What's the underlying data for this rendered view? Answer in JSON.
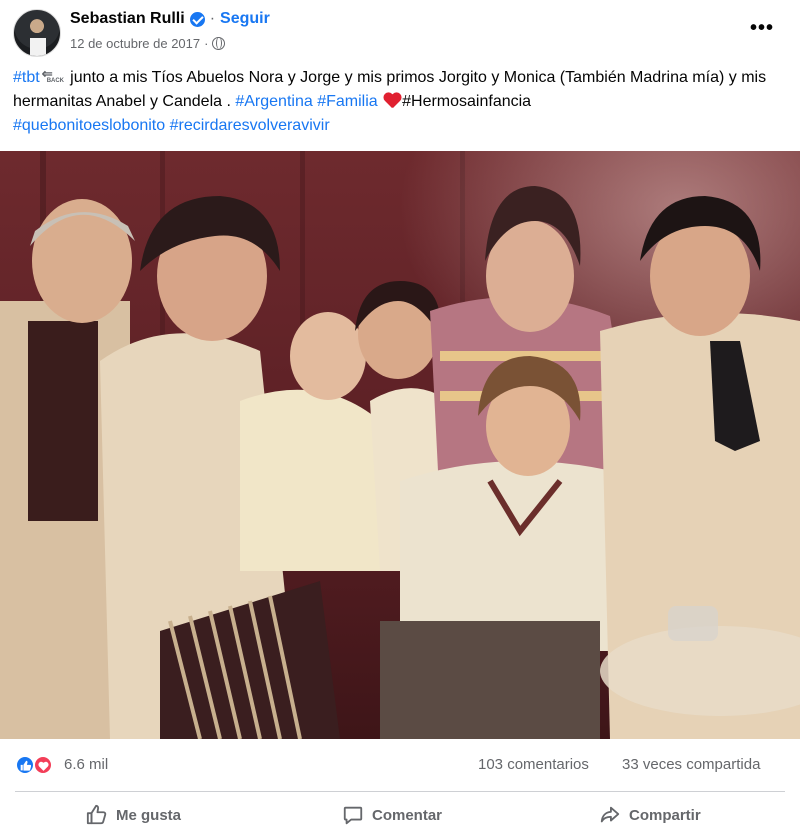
{
  "post": {
    "author": "Sebastian Rulli",
    "separator": "·",
    "follow_label": "Seguir",
    "date": "12 de octubre de 2017",
    "meta_separator": "·",
    "more_label": "•••"
  },
  "caption": {
    "tbt": "#tbt",
    "tbt_badge": "BACK",
    "text1": " junto a mis Tíos Abuelos Nora y Jorge y mis primos Jorgito y Monica (También Madrina mía) y mis hermanitas Anabel y Candela . ",
    "tag_argentina": "#Argentina",
    "tag_familia": "#Familia",
    "text2": "#Hermosainfancia",
    "tag_quebonito": "#quebonitoeslobonito",
    "tag_recordar": "#recirdaresvolveravivir"
  },
  "stats": {
    "reactions": "6.6 mil",
    "comments": "103 comentarios",
    "shares": "33 veces compartida"
  },
  "actions": {
    "like": "Me gusta",
    "comment": "Comentar",
    "share": "Compartir"
  },
  "colors": {
    "link": "#1877f2",
    "secondary_text": "#65676b",
    "photo_backdrop": "#5a1f24"
  },
  "icons": {
    "verified": "verified-badge-icon",
    "globe": "globe-icon",
    "more": "more-icon",
    "like": "thumbs-up-icon",
    "comment": "comment-bubble-icon",
    "share": "share-arrow-icon"
  }
}
